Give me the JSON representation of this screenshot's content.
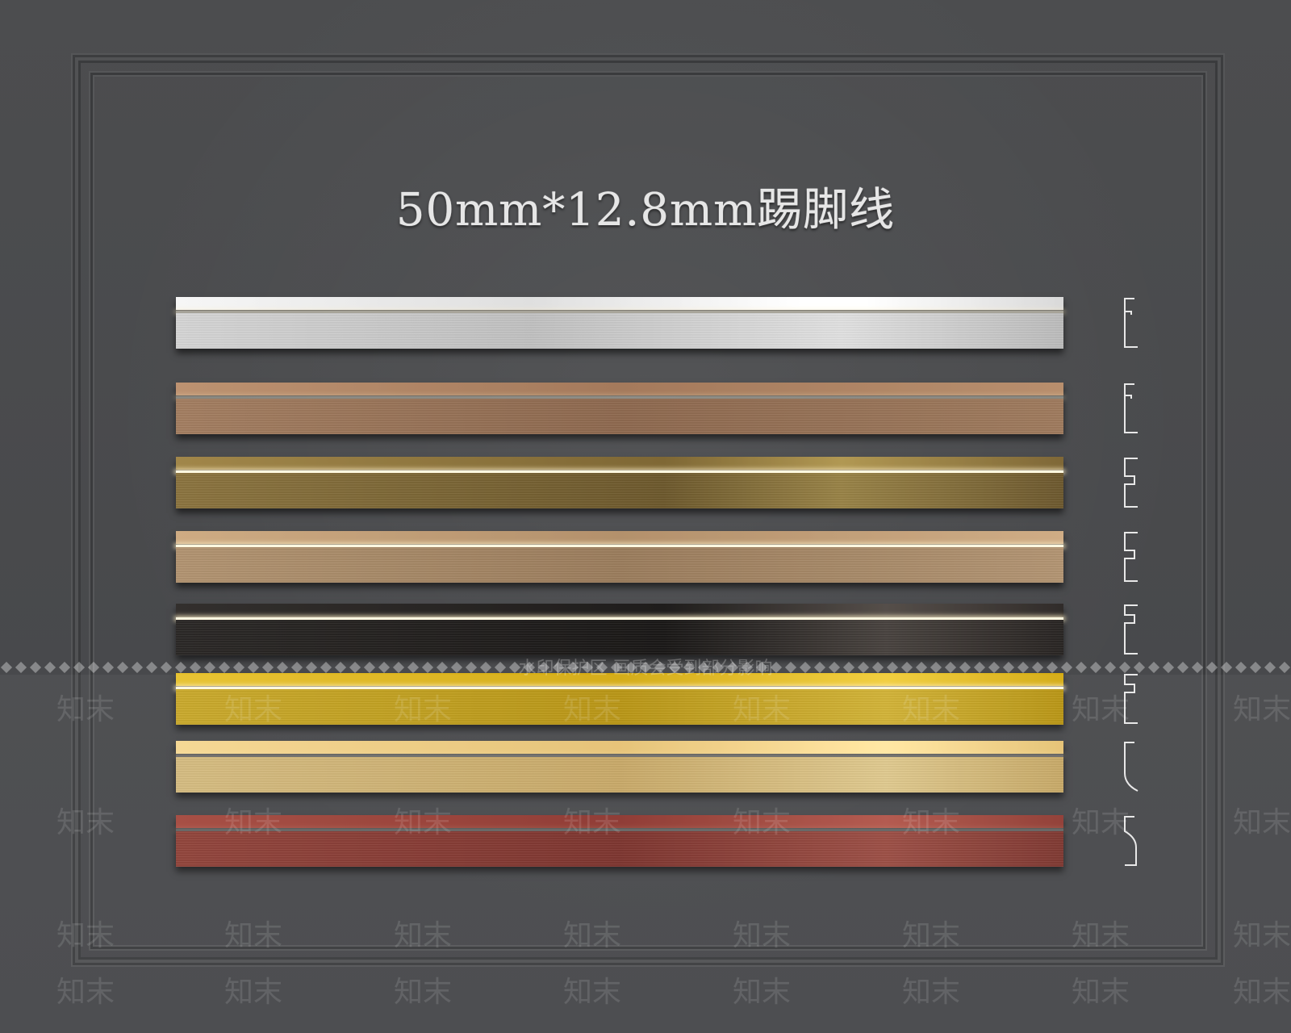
{
  "title": "50mm*12.8mm踢脚线",
  "profiles": [
    {
      "finish": "silver",
      "color": "#cfcfcf",
      "led": false
    },
    {
      "finish": "bronze",
      "color": "#9a755a",
      "led": false
    },
    {
      "finish": "antique-brass",
      "color": "#7e6838",
      "led": true
    },
    {
      "finish": "champagne",
      "color": "#a88a68",
      "led": true
    },
    {
      "finish": "black",
      "color": "#221f1d",
      "led": true
    },
    {
      "finish": "gold",
      "color": "#c19e1c",
      "led": true
    },
    {
      "finish": "pale-gold",
      "color": "#cfb274",
      "led": false
    },
    {
      "finish": "rose-red",
      "color": "#843832",
      "led": false
    }
  ],
  "watermark": {
    "notice": "水印保护区  画质会受到部分影响",
    "brand": "知末"
  }
}
